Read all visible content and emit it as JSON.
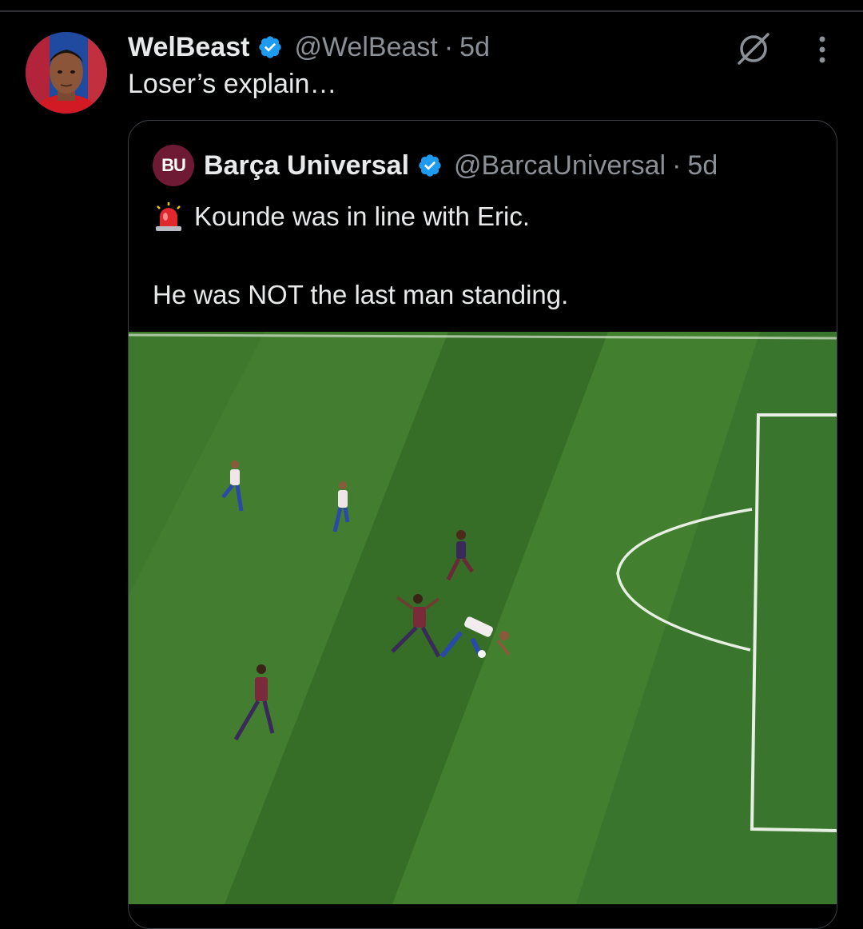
{
  "tweet": {
    "author_name": "WelBeast",
    "author_handle": "@WelBeast",
    "separator": "·",
    "time": "5d",
    "text": "Loser’s explain…",
    "icons": {
      "verified": "verified-badge-icon",
      "grok": "grok-icon",
      "more": "more-options-icon"
    },
    "colors": {
      "verified": "#1d9bf0",
      "background": "#000000",
      "secondary_text": "#8b9096"
    }
  },
  "quoted_tweet": {
    "avatar_text": "BU",
    "author_name": "Barça Universal",
    "author_handle": "@BarcaUniversal",
    "separator": "·",
    "time": "5d",
    "line1": "Kounde was in line with Eric.",
    "line2": "He was NOT the last man standing.",
    "icons": {
      "siren": "rotating-light-emoji",
      "verified": "verified-badge-icon"
    },
    "media": {
      "description_icon": "football-pitch-image"
    }
  }
}
